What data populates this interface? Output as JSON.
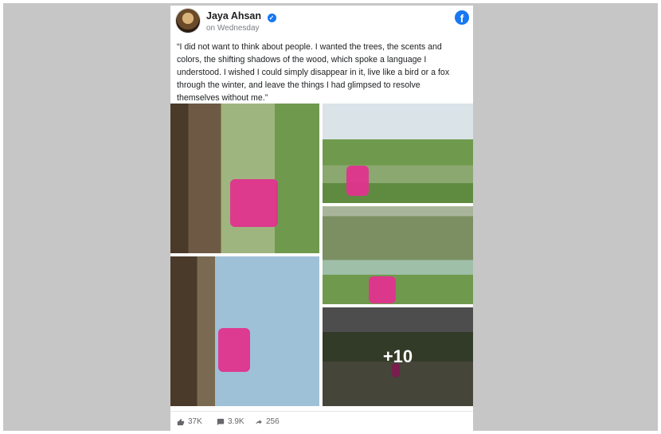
{
  "post": {
    "author_name": "Jaya Ahsan",
    "time_text": "on Wednesday",
    "text": "“I did not want to think about people. I wanted the trees, the scents and colors, the shifting shadows of the wood, which spoke a language I understood. I wished I could simply disappear in it, live like a bird or a fox through the winter, and leave the things I had glimpsed to resolve themselves without me.”",
    "more_photos_label": "+10",
    "stats": {
      "likes": "37K",
      "comments": "3.9K",
      "shares": "256"
    }
  },
  "icons": {
    "facebook": "facebook-icon",
    "verified": "verified-badge-icon",
    "like": "thumbs-up-icon",
    "comment": "comment-icon",
    "share": "share-icon"
  },
  "colors": {
    "facebook_blue": "#1877f2",
    "accent_pink": "#e0338e"
  }
}
